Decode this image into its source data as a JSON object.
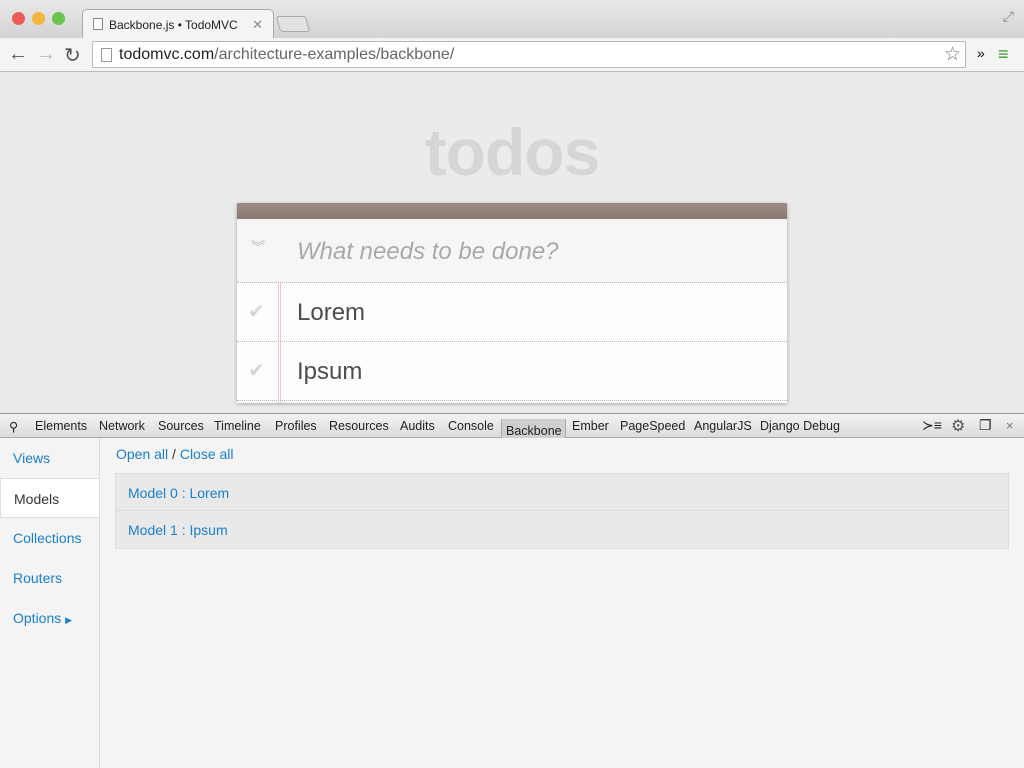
{
  "browser": {
    "tab_title": "Backbone.js • TodoMVC",
    "url_host": "todomvc.com",
    "url_path": "/architecture-examples/backbone/"
  },
  "app": {
    "title": "todos",
    "placeholder": "What needs to be done?",
    "todos": [
      {
        "title": "Lorem"
      },
      {
        "title": "Ipsum"
      }
    ]
  },
  "devtools": {
    "tabs": [
      "Elements",
      "Network",
      "Sources",
      "Timeline",
      "Profiles",
      "Resources",
      "Audits",
      "Console",
      "Backbone",
      "Ember",
      "PageSpeed",
      "AngularJS",
      "Django Debug"
    ],
    "active_tab": "Backbone"
  },
  "backbone": {
    "sidebar": [
      "Views",
      "Models",
      "Collections",
      "Routers",
      "Options"
    ],
    "active": "Models",
    "open_all": "Open all",
    "separator": "/",
    "close_all": "Close all",
    "models": [
      "Model 0 : Lorem",
      "Model 1 : Ipsum"
    ]
  }
}
